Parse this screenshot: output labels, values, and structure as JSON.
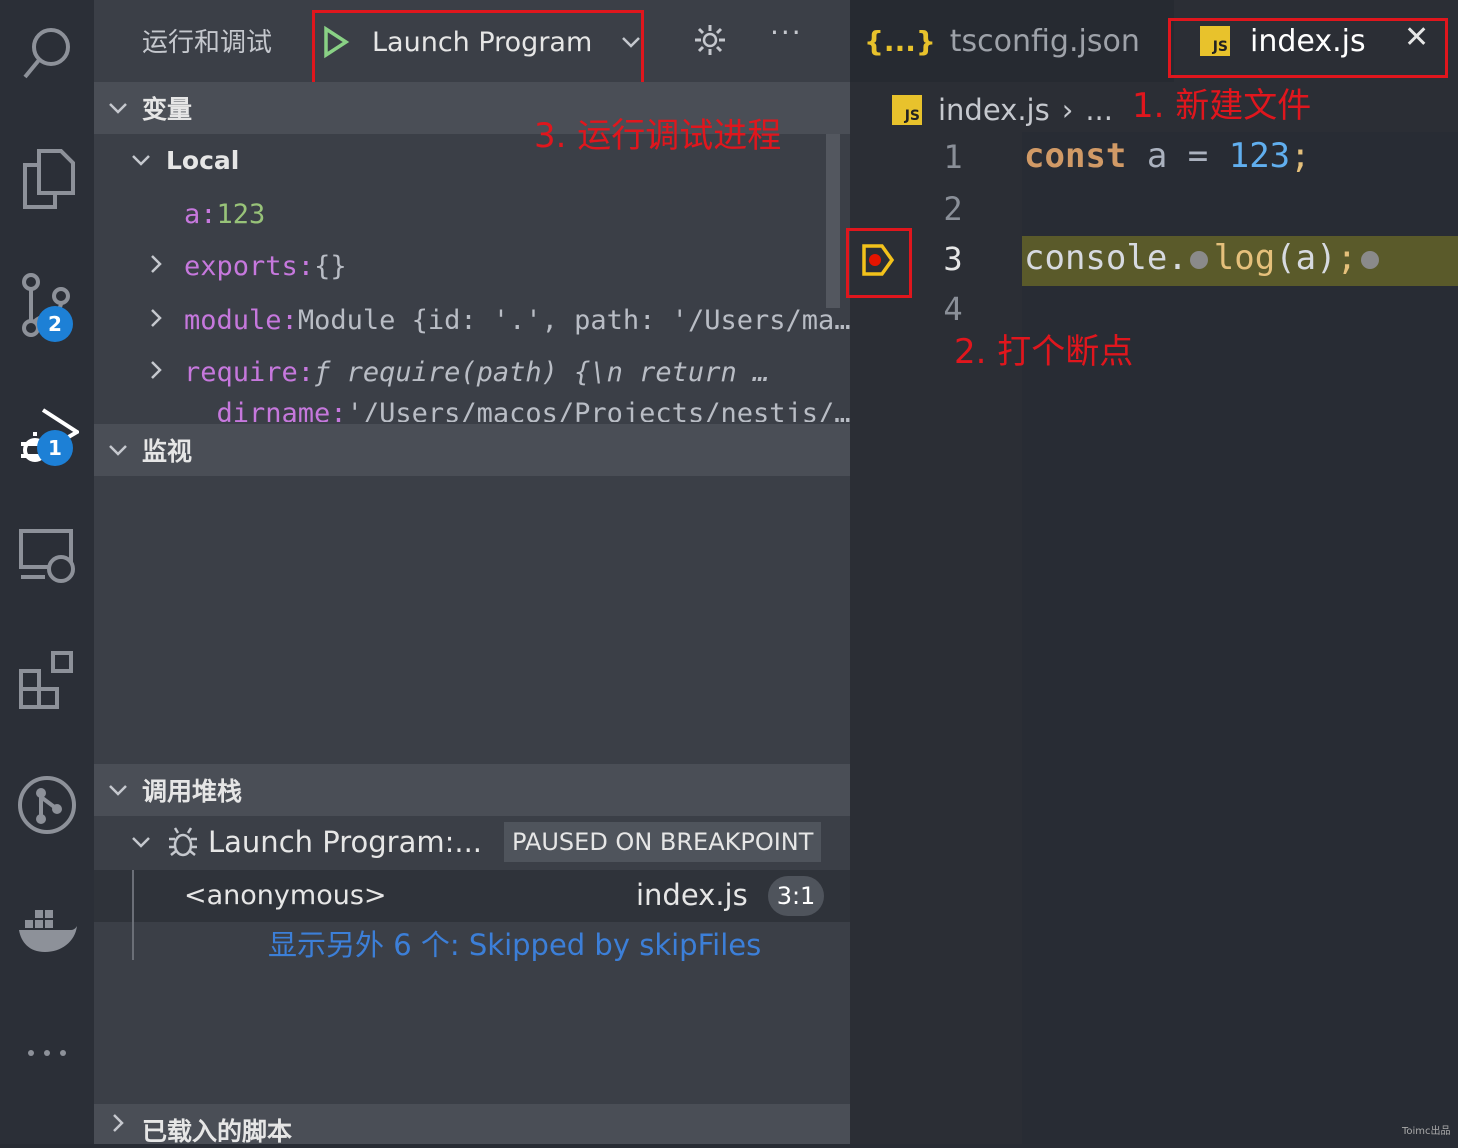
{
  "activity_bar": {
    "items": [
      {
        "icon": "search-icon"
      },
      {
        "icon": "files-icon"
      },
      {
        "icon": "source-control-icon",
        "badge": "2"
      },
      {
        "icon": "run-debug-icon",
        "badge": "1"
      },
      {
        "icon": "remote-explorer-icon"
      },
      {
        "icon": "extensions-icon"
      },
      {
        "icon": "git-graph-icon"
      },
      {
        "icon": "docker-icon"
      },
      {
        "icon": "more-icon"
      }
    ]
  },
  "debug_toolbar": {
    "view_title": "运行和调试",
    "config_label": "Launch Program",
    "more": "···"
  },
  "variables": {
    "title": "变量",
    "scope": "Local",
    "rows": [
      {
        "key": "a",
        "sep": ": ",
        "value": "123"
      },
      {
        "key": "exports",
        "sep": ": ",
        "value": "{}"
      },
      {
        "key": "module",
        "sep": ": ",
        "value": "Module {id: '.', path: '/Users/ma…"
      },
      {
        "key": "require",
        "sep": ": ",
        "value": "ƒ require(path) {\\n      return …"
      },
      {
        "key": "__dirname",
        "sep": ": ",
        "value": "'/Users/macos/Projects/nestjs/…"
      }
    ]
  },
  "watch": {
    "title": "监视"
  },
  "call_stack": {
    "title": "调用堆栈",
    "thread": "Launch Program:...",
    "status": "PAUSED ON BREAKPOINT",
    "frame": {
      "name": "<anonymous>",
      "file": "index.js",
      "pos": "3:1"
    },
    "skipped": "显示另外 6 个: Skipped by skipFiles"
  },
  "loaded_scripts": {
    "title": "已载入的脚本"
  },
  "editor": {
    "tabs": [
      {
        "icon": "{...}",
        "label": "tsconfig.json"
      },
      {
        "icon": "JS",
        "label": "index.js",
        "close": "✕"
      }
    ],
    "breadcrumb": {
      "file": "index.js",
      "sep": "›",
      "rest": "..."
    },
    "line_numbers": [
      "1",
      "2",
      "3",
      "4"
    ],
    "code": {
      "line1": {
        "kw": "const",
        "ident": " a ",
        "op": "= ",
        "num": "123",
        "end": ";"
      },
      "line3": {
        "obj": "console.",
        "fn": "log",
        "args": "(a)",
        "end": ";"
      }
    }
  },
  "annotations": {
    "step1": "1. 新建文件",
    "step2": "2. 打个断点",
    "step3": "3. 运行调试进程"
  },
  "watermark": "Toimc出品",
  "colors": {
    "annotation": "#e0161d",
    "badge": "#1d80d6",
    "js_icon": "#e8c22c",
    "current_line": "#5a5a2a"
  }
}
